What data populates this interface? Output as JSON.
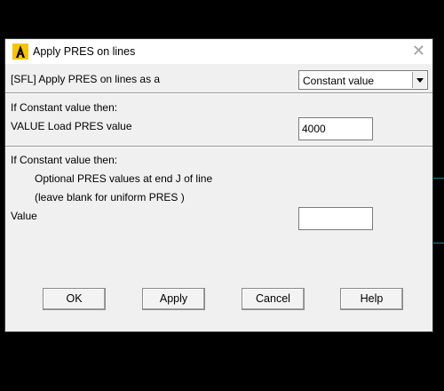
{
  "dialog": {
    "title": "Apply PRES on lines",
    "close_glyph": "✕"
  },
  "section1": {
    "label": "[SFL] Apply PRES on lines as a",
    "select_value": "Constant value"
  },
  "section2": {
    "heading": "If Constant value then:",
    "field_label": "VALUE  Load PRES value",
    "field_value": "4000"
  },
  "section3": {
    "heading": "If Constant value then:",
    "line1": "Optional PRES values at end J of line",
    "line2": "(leave blank for uniform PRES )",
    "field_label": "Value",
    "field_value": ""
  },
  "buttons": {
    "ok": "OK",
    "apply": "Apply",
    "cancel": "Cancel",
    "help": "Help"
  },
  "colors": {
    "dialog_bg": "#f0f0f0",
    "titlebar_bg": "#ffffff",
    "desktop_bg": "#000000",
    "accent_lines": "#1f7f9a",
    "app_icon": "#f5c400"
  }
}
